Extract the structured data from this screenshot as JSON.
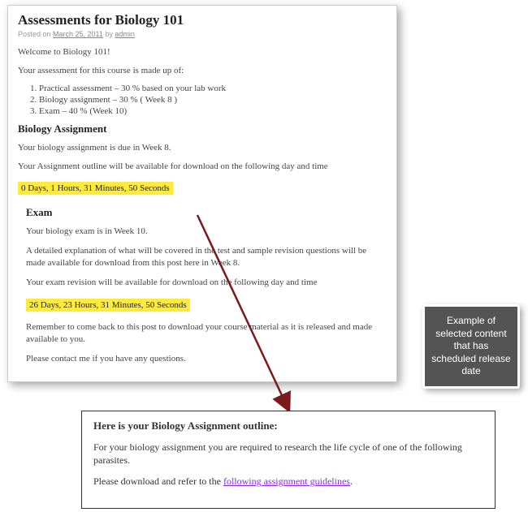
{
  "post": {
    "title": "Assessments for Biology 101",
    "meta_prefix": "Posted on ",
    "meta_date": "March 25, 2011",
    "meta_by": " by ",
    "meta_author": "admin",
    "welcome": "Welcome to Biology 101!",
    "intro": "Your assessment for this course is made up of:",
    "items": {
      "0": "Practical assessment – 30 % based on your lab work",
      "1": "Biology assignment – 30 % ( Week 8 )",
      "2": "Exam – 40 % (Week 10)"
    },
    "section1_title": "Biology Assignment",
    "section1_p1": "Your biology assignment is due in Week 8.",
    "section1_p2": "Your Assignment outline will be available for download on the following day and time",
    "countdown1": "0 Days, 1 Hours, 31 Minutes, 50 Seconds",
    "section2_title": "Exam",
    "section2_p1": "Your biology exam is in Week 10.",
    "section2_p2": "A detailed explanation of what will be covered in the test and sample revision questions will be made available for download from this post here in Week 8.",
    "section2_p3": "Your exam revision will be available for download on the following day and time",
    "countdown2": "26 Days, 23 Hours, 31 Minutes, 50 Seconds",
    "closing1": "Remember to come back to this post to download your course material as it is released and made available to you.",
    "closing2": "Please contact me if you have any questions."
  },
  "callout": "Example of selected content that has scheduled release date",
  "outline": {
    "title": "Here is your Biology Assignment outline:",
    "p1": "For your biology assignment you are required to research the life cycle of one of the following parasites.",
    "p2_prefix": "Please download and refer to the ",
    "p2_link": "following assignment guidelines",
    "p2_suffix": "."
  }
}
